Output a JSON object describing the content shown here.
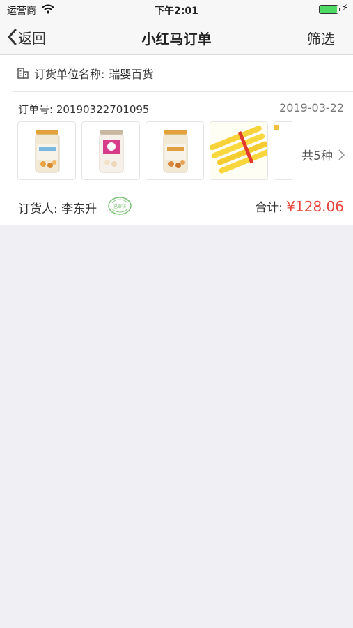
{
  "status_bar": {
    "carrier": "运营商",
    "time": "下午2:01",
    "battery_level": 1.0
  },
  "nav": {
    "back_label": "返回",
    "title": "小红马订单",
    "filter_label": "筛选"
  },
  "order": {
    "unit_label": "订货单位名称:",
    "unit_name": "瑞婴百货",
    "order_no_label": "订单号:",
    "order_no": "20190322701095",
    "date": "2019-03-22",
    "products": [
      {
        "kind": "jar-orange-lid"
      },
      {
        "kind": "jar-pink-label"
      },
      {
        "kind": "jar-orange-lid"
      },
      {
        "kind": "yellow-sausage-sticks"
      },
      {
        "kind": "partially-hidden"
      }
    ],
    "more_label": "共5种",
    "orderer_label": "订货人:",
    "orderer_name": "李东升",
    "badge_text": "已审核",
    "total_label": "合计:",
    "total_amount": "¥128.06"
  },
  "colors": {
    "accent_red": "#e8463f",
    "badge_green": "#7cc576",
    "battery_green": "#4cd964",
    "background": "#efeff4"
  }
}
